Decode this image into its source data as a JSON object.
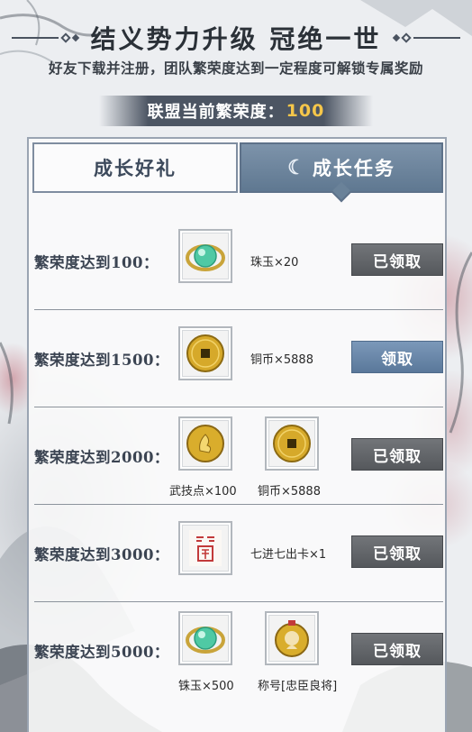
{
  "header": {
    "title": "结义势力升级 冠绝一世",
    "subtitle": "好友下载并注册，团队繁荣度达到一定程度可解锁专属奖励",
    "prosperity_label": "联盟当前繁荣度：",
    "prosperity_value": "100"
  },
  "tabs": [
    {
      "label": "成长好礼",
      "active": false
    },
    {
      "label": "成长任务",
      "active": true
    }
  ],
  "tasks": [
    {
      "requirement": "繁荣度达到100：",
      "rewards": [
        {
          "label": "珠玉×20",
          "icon": "jade-icon"
        }
      ],
      "button": "已领取",
      "status": "claimed"
    },
    {
      "requirement": "繁荣度达到1500：",
      "rewards": [
        {
          "label": "铜币×5888",
          "icon": "copper-coin-icon"
        }
      ],
      "button": "领取",
      "status": "claimable"
    },
    {
      "requirement": "繁荣度达到2000：",
      "rewards": [
        {
          "label": "武技点×100",
          "icon": "martial-token-icon"
        },
        {
          "label": "铜币×5888",
          "icon": "copper-coin-icon"
        }
      ],
      "button": "已领取",
      "status": "claimed"
    },
    {
      "requirement": "繁荣度达到3000：",
      "rewards": [
        {
          "label": "七进七出卡×1",
          "icon": "seal-card-icon"
        }
      ],
      "button": "已领取",
      "status": "claimed"
    },
    {
      "requirement": "繁荣度达到5000：",
      "rewards": [
        {
          "label": "铢玉×500",
          "icon": "jade-icon"
        },
        {
          "label": "称号[忠臣良将]",
          "icon": "title-medal-icon"
        }
      ],
      "button": "已领取",
      "status": "claimed"
    }
  ],
  "colors": {
    "accent_value": "#f5c64a",
    "tab_active": "#6a8299",
    "button_claimed": "#5e6165",
    "button_claimable": "#6886a8"
  }
}
